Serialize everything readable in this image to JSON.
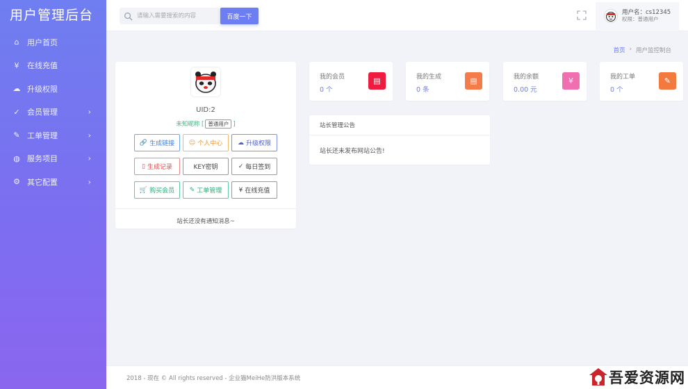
{
  "app": {
    "title": "用户管理后台"
  },
  "sidebar": {
    "items": [
      {
        "label": "用户首页",
        "icon": "home-icon",
        "glyph": "⌂",
        "has_submenu": false
      },
      {
        "label": "在线充值",
        "icon": "recharge-icon",
        "glyph": "¥",
        "has_submenu": false
      },
      {
        "label": "升级权限",
        "icon": "cloud-icon",
        "glyph": "☁",
        "has_submenu": false
      },
      {
        "label": "会员管理",
        "icon": "shield-icon",
        "glyph": "✓",
        "has_submenu": true
      },
      {
        "label": "工单管理",
        "icon": "ticket-icon",
        "glyph": "✎",
        "has_submenu": true
      },
      {
        "label": "服务项目",
        "icon": "globe-icon",
        "glyph": "◍",
        "has_submenu": true
      },
      {
        "label": "其它配置",
        "icon": "settings-icon",
        "glyph": "⚙",
        "has_submenu": true
      }
    ]
  },
  "header": {
    "search_placeholder": "请输入需要搜索的内容",
    "search_button": "百度一下",
    "user_name": "用户名：cs12345",
    "user_role": "权限：普通用户"
  },
  "breadcrumb": {
    "home": "首页",
    "sep": "›",
    "current": "用户监控制台"
  },
  "profile": {
    "uid": "UID:2",
    "nickname": "未知昵称",
    "role_tag": "普通用户",
    "buttons": [
      {
        "label": "生成链接",
        "glyph": "🔗",
        "color_class": "c-blue",
        "name": "generate-link-button"
      },
      {
        "label": "个人中心",
        "glyph": "☺",
        "color_class": "c-orange",
        "name": "personal-center-button"
      },
      {
        "label": "升级权限",
        "glyph": "☁",
        "color_class": "c-indigo",
        "name": "upgrade-permission-button"
      },
      {
        "label": "生成记录",
        "glyph": "▯",
        "color_class": "c-red",
        "name": "generation-records-button"
      },
      {
        "label": "KEY密钥",
        "glyph": "",
        "color_class": "c-gray",
        "name": "key-secret-button"
      },
      {
        "label": "每日签到",
        "glyph": "✓",
        "color_class": "c-gray",
        "name": "daily-checkin-button"
      },
      {
        "label": "购买会员",
        "glyph": "🛒",
        "color_class": "c-green",
        "name": "buy-membership-button"
      },
      {
        "label": "工单管理",
        "glyph": "✎",
        "color_class": "c-green",
        "name": "ticket-management-button"
      },
      {
        "label": "在线充值",
        "glyph": "¥",
        "color_class": "c-gray",
        "name": "online-recharge-button"
      }
    ],
    "notice": "站长还没有通知消息~"
  },
  "stats": [
    {
      "label": "我的会员",
      "value": "0 个",
      "color": "#ee1d3f",
      "glyph": "▤",
      "name": "my-members"
    },
    {
      "label": "我的生成",
      "value": "0 条",
      "color": "#f47c4a",
      "glyph": "▤",
      "name": "my-generations"
    },
    {
      "label": "我的余额",
      "value": "0.00 元",
      "color": "#f06fb0",
      "glyph": "¥",
      "name": "my-balance"
    },
    {
      "label": "我的工单",
      "value": "0 个",
      "color": "#f37a3e",
      "glyph": "✎",
      "name": "my-tickets"
    }
  ],
  "announcement": {
    "title": "站长管理公告",
    "body": "站长还未发布网站公告!"
  },
  "footer": {
    "text": "2018 - 现在 © All rights reserved - 企业猫MeiHe防洪版本系统"
  },
  "watermark": {
    "text": "吾爱资源网"
  },
  "colors": {
    "accent": "#6c7ef1",
    "sidebar_top": "#6f7ef0",
    "sidebar_bottom": "#8a66ef"
  }
}
